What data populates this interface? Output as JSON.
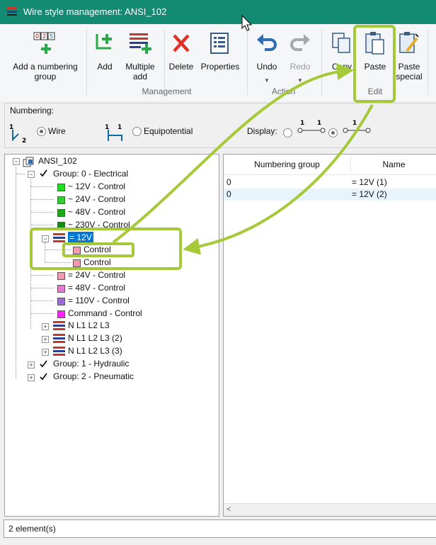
{
  "window": {
    "title": "Wire style management: ANSI_102"
  },
  "ribbon": {
    "add_numbering_group": "Add a numbering group",
    "add": "Add",
    "multiple_add": "Multiple add",
    "delete": "Delete",
    "properties": "Properties",
    "undo": "Undo",
    "redo": "Redo",
    "copy": "Copy",
    "paste": "Paste",
    "paste_special": "Paste special",
    "groups": {
      "management": "Management",
      "action": "Action",
      "edit": "Edit"
    }
  },
  "numbering": {
    "label": "Numbering:",
    "wire": "Wire",
    "equipotential": "Equipotential",
    "wire_selected": true,
    "display_label": "Display:",
    "display_selected_index": 1
  },
  "tree": {
    "root": "ANSI_102",
    "group0": "Group: 0 - Electrical",
    "items": [
      {
        "text": "~  12V - Control",
        "color": "#22dd22"
      },
      {
        "text": "~  24V - Control",
        "color": "#33cc33"
      },
      {
        "text": "~  48V - Control",
        "color": "#1aaa1a"
      },
      {
        "text": "~  230V - Control",
        "color": "#138a13"
      }
    ],
    "selected_node": "=  12V",
    "children": [
      "Control",
      "Control"
    ],
    "child_color": "#f49ab0",
    "items2": [
      {
        "text": "=  24V - Control",
        "color": "#f49ab0"
      },
      {
        "text": "=  48V - Control",
        "color": "#e37ad3"
      },
      {
        "text": "=  110V - Control",
        "color": "#9b6ed3"
      },
      {
        "text": "Command - Control",
        "color": "#ff22ff"
      }
    ],
    "multi_items": [
      "N L1 L2 L3",
      "N L1 L2 L3 (2)",
      "N L1 L2 L3 (3)"
    ],
    "group1": "Group: 1 - Hydraulic",
    "group2": "Group: 2 - Pneumatic"
  },
  "grid": {
    "columns": [
      "Numbering group",
      "Name"
    ],
    "rows": [
      {
        "group": "0",
        "name": "=  12V (1)"
      },
      {
        "group": "0",
        "name": "=  12V (2)"
      }
    ]
  },
  "status": {
    "text": "2 element(s)"
  },
  "colors": {
    "titlebar": "#138a72",
    "annotation": "#a6c93a",
    "selection": "#0078d7"
  }
}
